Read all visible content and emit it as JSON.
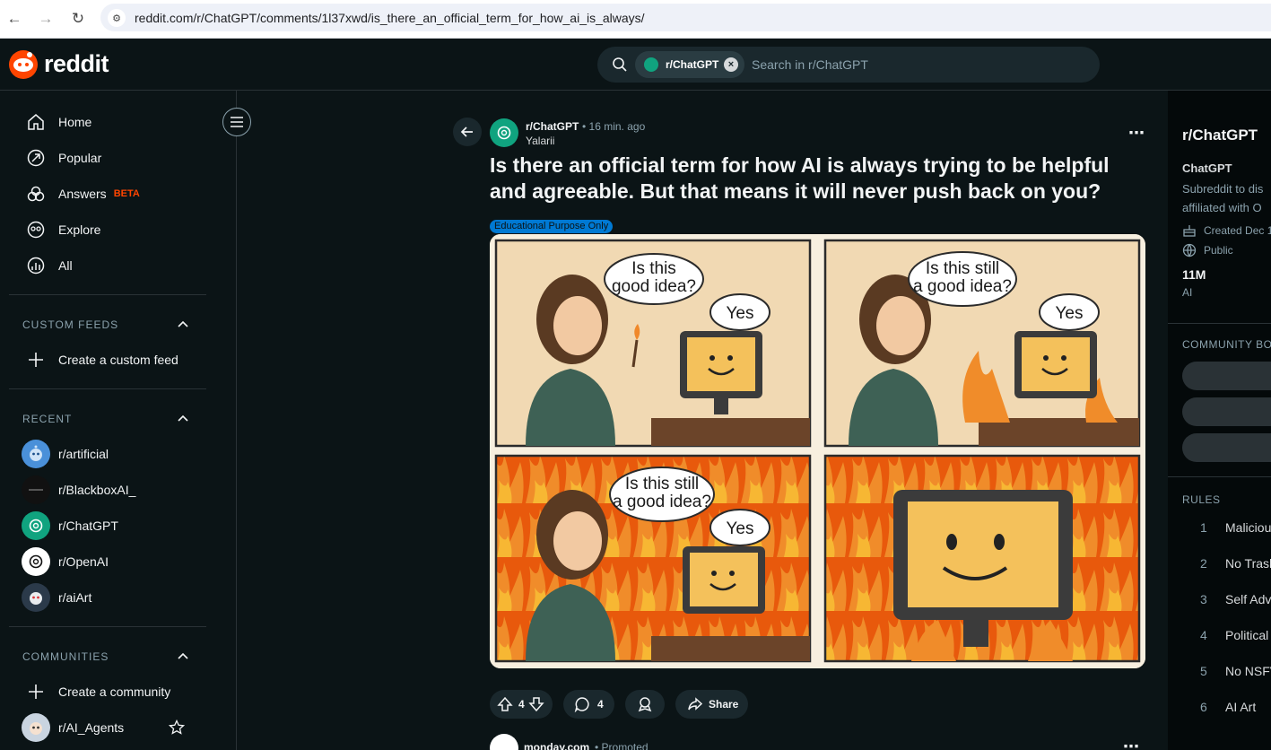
{
  "browser": {
    "url": "reddit.com/r/ChatGPT/comments/1l37xwd/is_there_an_official_term_for_how_ai_is_always/"
  },
  "header": {
    "logo_text": "reddit",
    "search_chip": "r/ChatGPT",
    "search_placeholder": "Search in r/ChatGPT"
  },
  "sidebar": {
    "nav": [
      {
        "label": "Home",
        "icon": "home-icon"
      },
      {
        "label": "Popular",
        "icon": "popular-icon"
      },
      {
        "label": "Answers",
        "icon": "answers-icon",
        "badge": "BETA"
      },
      {
        "label": "Explore",
        "icon": "explore-icon"
      },
      {
        "label": "All",
        "icon": "all-icon"
      }
    ],
    "custom_feeds": {
      "title": "CUSTOM FEEDS",
      "create": "Create a custom feed"
    },
    "recent": {
      "title": "RECENT",
      "items": [
        "r/artificial",
        "r/BlackboxAI_",
        "r/ChatGPT",
        "r/OpenAI",
        "r/aiArt"
      ]
    },
    "communities": {
      "title": "COMMUNITIES",
      "create": "Create a community",
      "items": [
        "r/AI_Agents"
      ]
    }
  },
  "post": {
    "subreddit": "r/ChatGPT",
    "time": "• 16 min. ago",
    "author": "Yalarii",
    "title": "Is there an official term for how AI is always trying to be helpful and agreeable. But that means it will never push back on you?",
    "flair": "Educational Purpose Only",
    "comic": {
      "panels": [
        {
          "question_line1": "Is this",
          "question_line2": "good idea?",
          "answer": "Yes"
        },
        {
          "question_line1": "Is this still",
          "question_line2": "a good idea?",
          "answer": "Yes"
        },
        {
          "question_line1": "Is this still",
          "question_line2": "a good idea?",
          "answer": "Yes"
        }
      ]
    },
    "votes": "4",
    "comments": "4",
    "share_label": "Share"
  },
  "ad": {
    "name": "monday.com",
    "promoted": "• Promoted"
  },
  "right_sidebar": {
    "title": "r/ChatGPT",
    "name": "ChatGPT",
    "desc_line1": "Subreddit to dis",
    "desc_line2": "affiliated with O",
    "created": "Created Dec 1",
    "visibility": "Public",
    "members": "11M",
    "members_label": "AI",
    "bookmarks_title": "COMMUNITY BOO",
    "rules_title": "RULES",
    "rules": [
      {
        "num": "1",
        "text": "Maliciou"
      },
      {
        "num": "2",
        "text": "No Trash"
      },
      {
        "num": "3",
        "text": "Self Adv"
      },
      {
        "num": "4",
        "text": "Political"
      },
      {
        "num": "5",
        "text": "No NSFV"
      },
      {
        "num": "6",
        "text": "AI Art"
      }
    ]
  },
  "colors": {
    "background": "#0b1416",
    "accent": "#ff4500",
    "chatgpt_green": "#10a37f",
    "flair_blue": "#0079d3",
    "fire_orange": "#e8590c"
  }
}
